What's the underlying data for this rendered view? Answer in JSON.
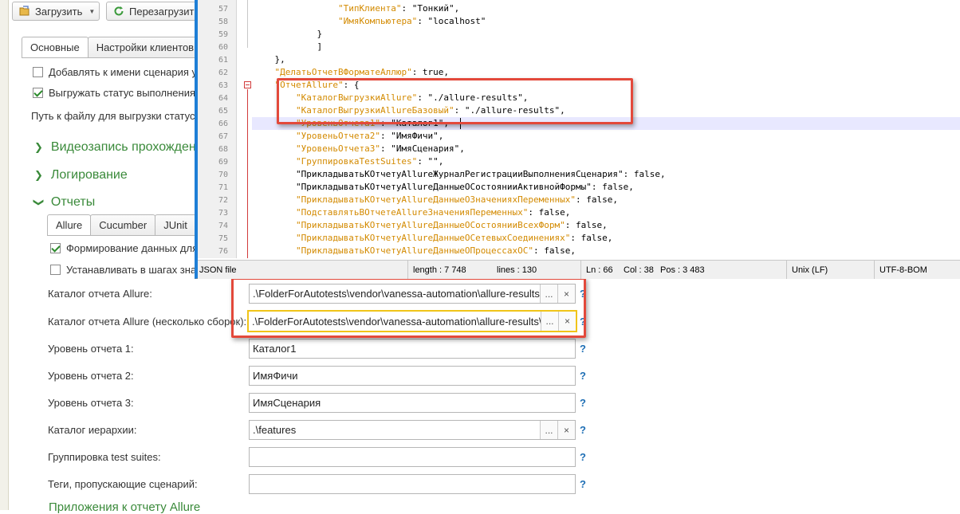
{
  "toolbar": {
    "load_label": "Загрузить",
    "reload_label": "Перезагрузит"
  },
  "main_tabs": [
    {
      "label": "Основные"
    },
    {
      "label": "Настройки клиентов"
    }
  ],
  "options": {
    "add_to_name": "Добавлять к имени сценария у",
    "export_status": "Выгружать статус выполнения",
    "status_path": "Путь к файлу для выгрузки статус"
  },
  "sections": {
    "video": "Видеозапись прохожден",
    "logging": "Логирование",
    "reports": "Отчеты",
    "attachments": "Приложения к отчету Allure"
  },
  "report_tabs": [
    {
      "label": "Allure"
    },
    {
      "label": "Cucumber"
    },
    {
      "label": "JUnit"
    }
  ],
  "allure": {
    "generate": "Формирование данных для",
    "set_in_steps": "Устанавливать в шагах зна"
  },
  "fields": [
    {
      "label": "Каталог отчета  Allure:",
      "value": ".\\FolderForAutotests\\vendor\\vanessa-automation\\allure-results\\"
    },
    {
      "label": "Каталог отчета Allure (несколько сборок):",
      "value": ".\\FolderForAutotests\\vendor\\vanessa-automation\\allure-results\\"
    },
    {
      "label": "Уровень отчета 1:",
      "value": "Каталог1"
    },
    {
      "label": "Уровень отчета 2:",
      "value": "ИмяФичи"
    },
    {
      "label": "Уровень отчета 3:",
      "value": "ИмяСценария"
    },
    {
      "label": "Каталог иерархии:",
      "value": ".\\features"
    },
    {
      "label": "Группировка test suites:",
      "value": ""
    },
    {
      "label": "Теги, пропускающие сценарий:",
      "value": ""
    }
  ],
  "field_buttons": {
    "browse": "...",
    "clear": "×",
    "help": "?"
  },
  "editor": {
    "lines": [
      {
        "num": "57",
        "indent": "                ",
        "key": "\"ТипКлиента\"",
        "rest": ": \"Тонкий\","
      },
      {
        "num": "58",
        "indent": "                ",
        "key": "\"ИмяКомпьютера\"",
        "rest": ": \"localhost\""
      },
      {
        "num": "59",
        "indent": "            ",
        "key": "",
        "rest": "}"
      },
      {
        "num": "60",
        "indent": "            ",
        "key": "",
        "rest": "]"
      },
      {
        "num": "61",
        "indent": "    ",
        "key": "",
        "rest": "},"
      },
      {
        "num": "62",
        "indent": "    ",
        "key": "\"ДелатьОтчетВФорматеАллюр\"",
        "rest": ": true,"
      },
      {
        "num": "63",
        "indent": "    ",
        "key": "\"ОтчетAllure\"",
        "rest": ": {"
      },
      {
        "num": "64",
        "indent": "        ",
        "key": "\"КаталогВыгрузкиAllure\"",
        "rest": ": \"./allure-results\","
      },
      {
        "num": "65",
        "indent": "        ",
        "key": "\"КаталогВыгрузкиAllureБазовый\"",
        "rest": ": \"./allure-results\","
      },
      {
        "num": "66",
        "indent": "        ",
        "key": "\"УровеньОтчета1\"",
        "rest": ": \"Каталог1\","
      },
      {
        "num": "67",
        "indent": "        ",
        "key": "\"УровеньОтчета2\"",
        "rest": ": \"ИмяФичи\","
      },
      {
        "num": "68",
        "indent": "        ",
        "key": "\"УровеньОтчета3\"",
        "rest": ": \"ИмяСценария\","
      },
      {
        "num": "69",
        "indent": "        ",
        "key": "\"ГруппировкаTestSuites\"",
        "rest": ": \"\","
      },
      {
        "num": "70",
        "indent": "        ",
        "key": "",
        "rest": "\"ПрикладыватьКОтчетуAllureЖурналРегистрацииВыполненияСценария\": false,"
      },
      {
        "num": "71",
        "indent": "        ",
        "key": "",
        "rest": "\"ПрикладыватьКОтчетуAllureДанныеОСостоянииАктивнойФормы\": false,"
      },
      {
        "num": "72",
        "indent": "        ",
        "key": "\"ПрикладыватьКОтчетуAllureДанныеОЗначенияхПеременных\"",
        "rest": ": false,"
      },
      {
        "num": "73",
        "indent": "        ",
        "key": "\"ПодставлятьВОтчетеAllureЗначенияПеременных\"",
        "rest": ": false,"
      },
      {
        "num": "74",
        "indent": "        ",
        "key": "\"ПрикладыватьКОтчетуAllureДанныеОСостоянииВсехФорм\"",
        "rest": ": false,"
      },
      {
        "num": "75",
        "indent": "        ",
        "key": "\"ПрикладыватьКОтчетуAllureДанныеОСетевыхСоединениях\"",
        "rest": ": false,"
      },
      {
        "num": "76",
        "indent": "        ",
        "key": "\"ПрикладыватьКОтчетуAllureДанныеОПроцессахОС\"",
        "rest": ": false,"
      }
    ],
    "status": {
      "file_type": "JSON file",
      "length": "length : 7 748",
      "lines": "lines : 130",
      "ln": "Ln : 66",
      "col": "Col : 38",
      "pos": "Pos : 3 483",
      "eol": "Unix (LF)",
      "encoding": "UTF-8-BOM"
    }
  },
  "colors": {
    "highlight": "#e3493b",
    "section_green": "#3a8a3a",
    "json_key": "#d38a00",
    "editor_border": "#1e7fd6",
    "focus": "#f0c419"
  }
}
